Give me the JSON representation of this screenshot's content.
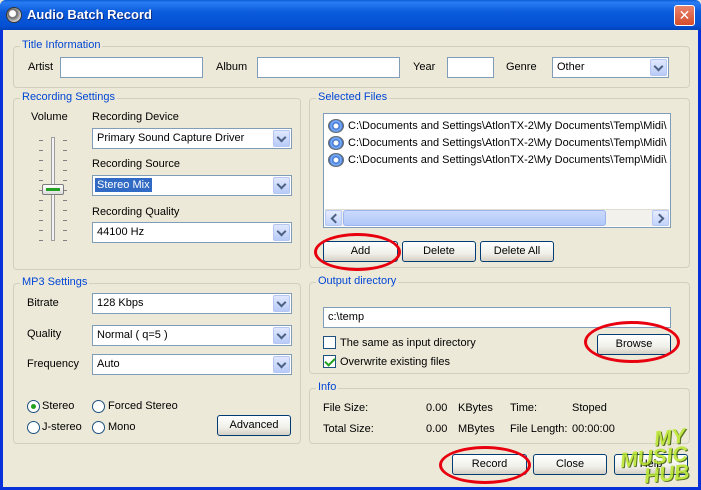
{
  "window": {
    "title": "Audio Batch Record",
    "close_glyph": "✕"
  },
  "title_info": {
    "label": "Title Information",
    "artist_label": "Artist",
    "artist_value": "",
    "album_label": "Album",
    "album_value": "",
    "year_label": "Year",
    "year_value": "",
    "genre_label": "Genre",
    "genre_value": "Other"
  },
  "recording": {
    "label": "Recording Settings",
    "volume_label": "Volume",
    "volume_level": 0.5,
    "device_label": "Recording Device",
    "device_value": "Primary Sound Capture Driver",
    "source_label": "Recording Source",
    "source_value": "Stereo Mix",
    "quality_label": "Recording Quality",
    "quality_value": "44100 Hz"
  },
  "selected_files": {
    "label": "Selected Files",
    "files": [
      "C:\\Documents and Settings\\AtlonTX-2\\My Documents\\Temp\\Midi\\",
      "C:\\Documents and Settings\\AtlonTX-2\\My Documents\\Temp\\Midi\\",
      "C:\\Documents and Settings\\AtlonTX-2\\My Documents\\Temp\\Midi\\"
    ],
    "add_label": "Add",
    "delete_label": "Delete",
    "delete_all_label": "Delete All"
  },
  "mp3": {
    "label": "MP3 Settings",
    "bitrate_label": "Bitrate",
    "bitrate_value": "128 Kbps",
    "quality_label": "Quality",
    "quality_value": "Normal ( q=5 )",
    "frequency_label": "Frequency",
    "frequency_value": "Auto",
    "stereo_label": "Stereo",
    "forced_stereo_label": "Forced Stereo",
    "jstereo_label": "J-stereo",
    "mono_label": "Mono",
    "selected_mode": "Stereo",
    "advanced_label": "Advanced"
  },
  "output": {
    "label": "Output directory",
    "path_value": "c:\\temp",
    "same_as_input_label": "The same as input directory",
    "same_as_input_checked": false,
    "overwrite_label": "Overwrite existing files",
    "overwrite_checked": true,
    "browse_label": "Browse"
  },
  "info": {
    "label": "Info",
    "file_size_label": "File Size:",
    "file_size_value": "0.00",
    "file_size_unit": "KBytes",
    "total_size_label": "Total Size:",
    "total_size_value": "0.00",
    "total_size_unit": "MBytes",
    "time_label": "Time:",
    "time_value": "Stoped",
    "file_length_label": "File Length:",
    "file_length_value": "00:00:00"
  },
  "footer": {
    "record_label": "Record",
    "close_label": "Close",
    "help_label": "Help"
  },
  "watermark": {
    "line1": "MY",
    "line2": "MUSIC",
    "line3": "HUB"
  },
  "colors": {
    "group_label": "#0046d5",
    "annotation": "#e8000f",
    "selection": "#316ac5"
  }
}
